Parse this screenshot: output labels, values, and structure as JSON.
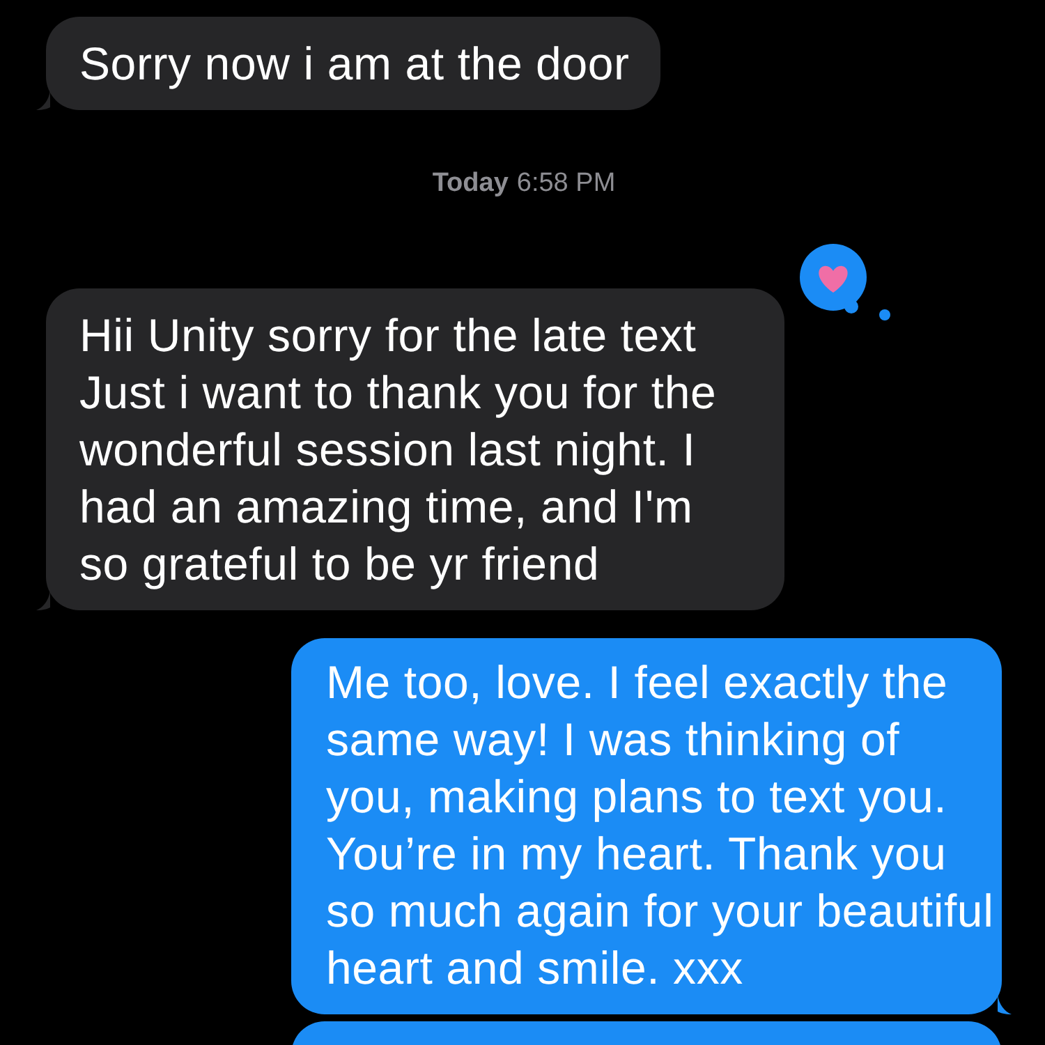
{
  "messages": [
    {
      "kind": "received",
      "text": "Sorry now i am at the door"
    },
    {
      "kind": "timestamp",
      "day": "Today",
      "time": "6:58 PM"
    },
    {
      "kind": "received",
      "text": "Hii Unity sorry for the late text Just i want to thank you for the wonderful session last night. I had an amazing time, and I'm so grateful to be yr friend",
      "reaction": {
        "kind": "heart"
      }
    },
    {
      "kind": "sent",
      "text": "Me too, love. I feel exactly the same way! I was thinking of you, making plans to text you. You’re in my heart. Thank you so much again for your beautiful heart and smile. xxx"
    },
    {
      "kind": "sent-partial"
    }
  ]
}
